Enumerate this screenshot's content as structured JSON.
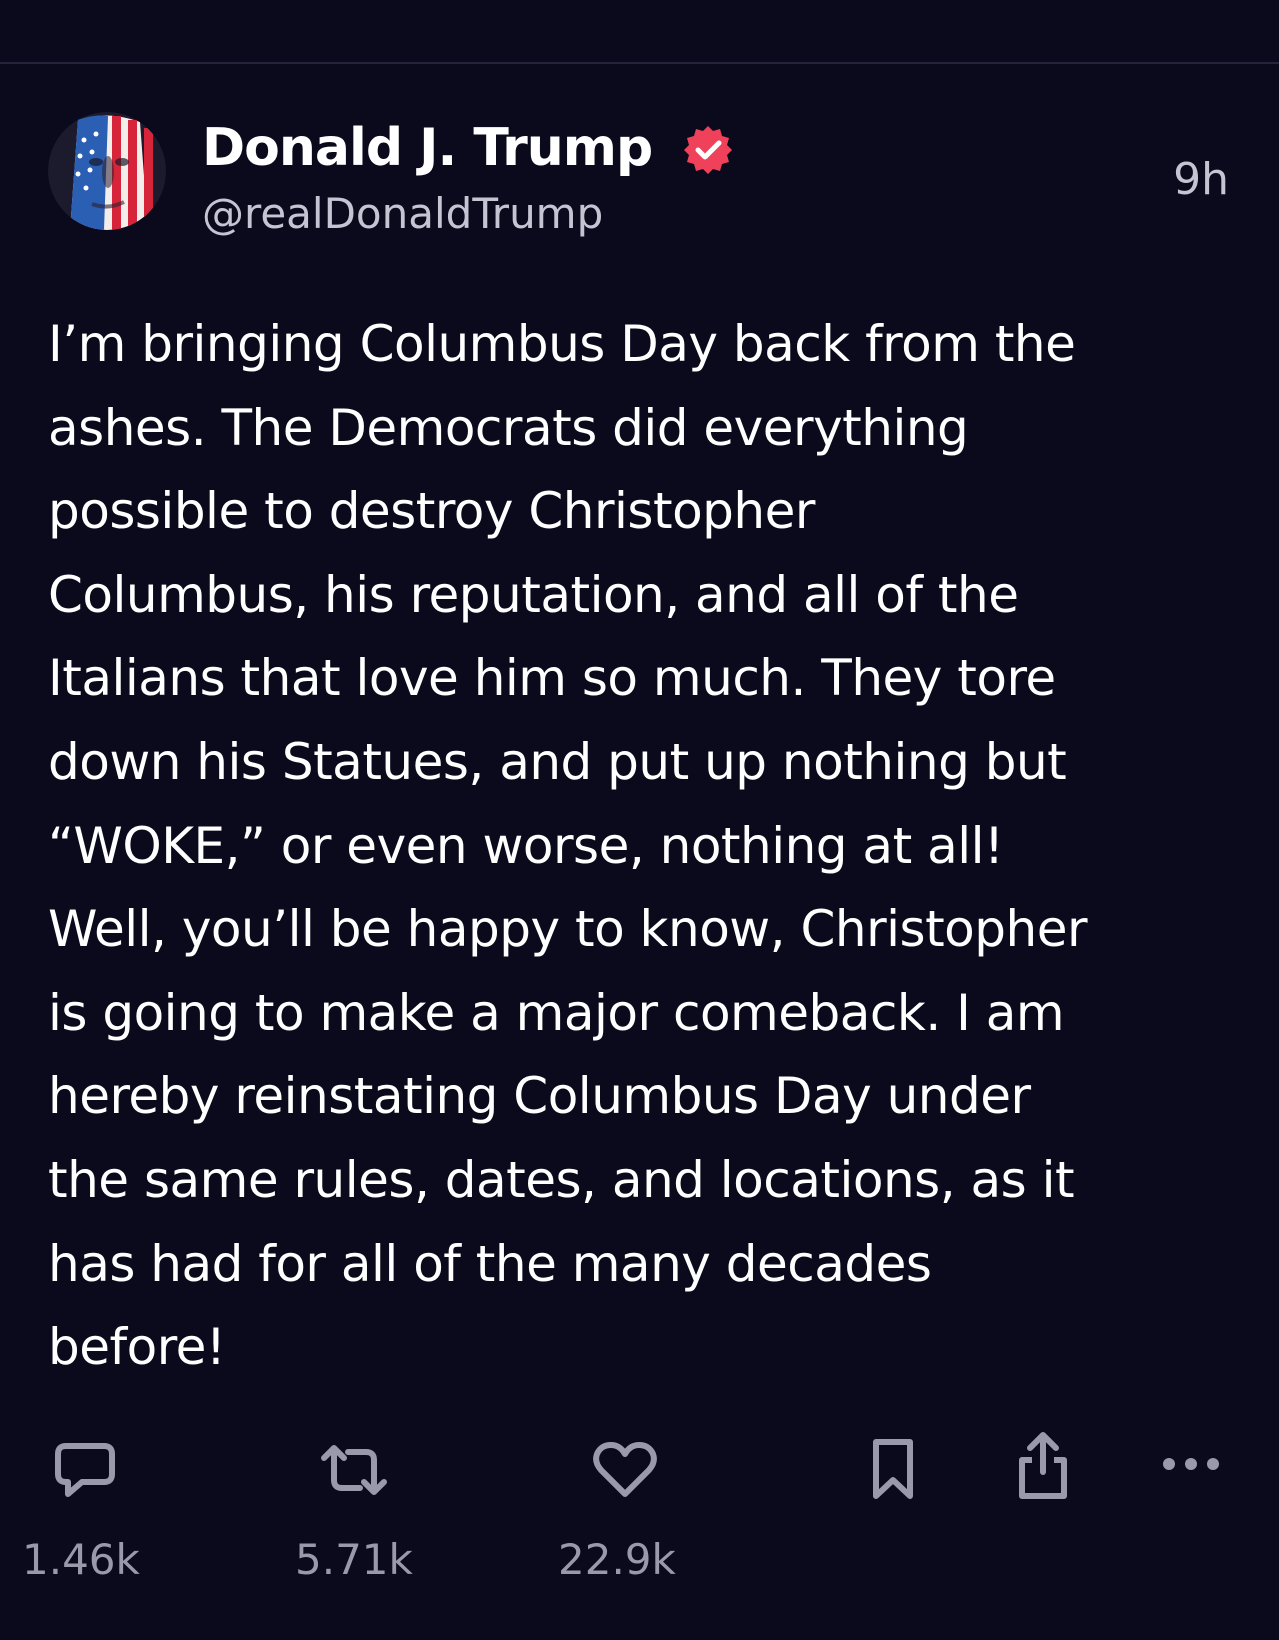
{
  "post": {
    "author_name": "Donald J. Trump",
    "handle": "@realDonaldTrump",
    "timestamp": "9h",
    "verified": true,
    "body": "I’m bringing Columbus Day back from the\nashes. The Democrats did everything\npossible to destroy Christopher\nColumbus, his reputation, and all of the\nItalians that love him so much. They tore\ndown his Statues, and put up nothing but\n“WOKE,” or even worse, nothing at all!\nWell, you’ll be happy to know, Christopher\nis going to make a major comeback. I am\nhereby reinstating Columbus Day under\nthe same rules, dates, and locations, as it\nhas had for all of the many decades\nbefore!"
  },
  "actions": {
    "reply": {
      "icon": "comment-icon",
      "count": "1.46k"
    },
    "repost": {
      "icon": "repost-icon",
      "count": "5.71k"
    },
    "like": {
      "icon": "heart-icon",
      "count": "22.9k"
    },
    "bookmark": {
      "icon": "bookmark-icon"
    },
    "share": {
      "icon": "share-icon"
    },
    "more": {
      "icon": "more-horizontal-icon"
    }
  },
  "colors": {
    "background": "#0b0a1c",
    "text_primary": "#ffffff",
    "text_secondary": "#c5c4d3",
    "icon_gray": "#9a99ab",
    "verified_badge": "#f0415a"
  }
}
